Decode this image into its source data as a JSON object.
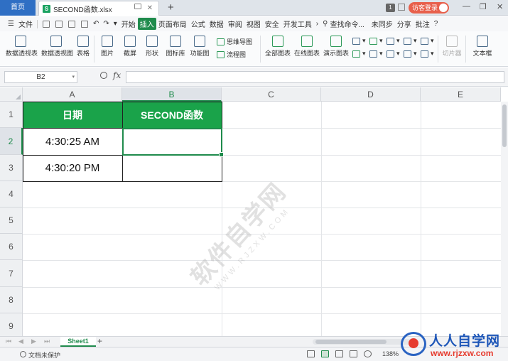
{
  "titlebar": {
    "home_tab": "首页",
    "file_tab": "SECOND函数.xlsx",
    "file_icon": "S",
    "badge": "1",
    "login": "访客登录"
  },
  "menu": {
    "file": "文件",
    "items": [
      "开始",
      "插入",
      "页面布局",
      "公式",
      "数据",
      "审阅",
      "视图",
      "安全",
      "开发工具"
    ],
    "active": "插入",
    "search": "查找命令...",
    "sync": "未同步",
    "share": "分享",
    "comment": "批注",
    "help": "?"
  },
  "ribbon": {
    "buttons": [
      "数据透视表",
      "数据透视图",
      "表格",
      "图片",
      "截屏",
      "形状",
      "图标库",
      "功能图",
      "全部图表",
      "在线图表",
      "演示图表",
      "切片器",
      "文本框"
    ],
    "mindmap": "思维导图",
    "flowchart": "流程图"
  },
  "formula_bar": {
    "name_box": "B2",
    "fx": "fx",
    "formula": ""
  },
  "columns": [
    "A",
    "B",
    "C",
    "D",
    "E"
  ],
  "rows": [
    "1",
    "2",
    "3",
    "4",
    "5",
    "6",
    "7",
    "8",
    "9"
  ],
  "table": {
    "header_a": "日期",
    "header_b": "SECOND函数",
    "a2": "4:30:25 AM",
    "a3": "4:30:20 PM",
    "b2": "",
    "b3": ""
  },
  "selected_cell": "B2",
  "watermark": {
    "text": "软件自学网",
    "url": "WWW.RJZXW.COM"
  },
  "sheets": [
    "Sheet1"
  ],
  "status": {
    "protection": "文档未保护",
    "zoom": "138%"
  },
  "logo": {
    "text": "人人自学网",
    "url": "www.rjzxw.com"
  },
  "colors": {
    "header_fill": "#1aa34a",
    "accent": "#1f8b4c",
    "home_tab": "#2f6fc4"
  }
}
